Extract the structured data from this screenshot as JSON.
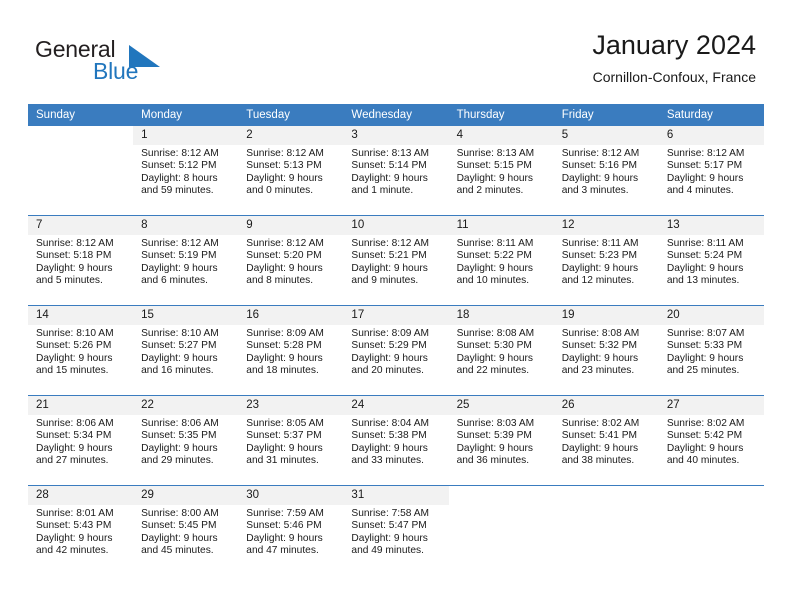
{
  "brand": {
    "word1": "General",
    "word2": "Blue",
    "flag_icon": "blue-triangle-flag-icon",
    "colors": {
      "blue": "#2176bd",
      "dark": "#231f20"
    }
  },
  "header": {
    "title": "January 2024",
    "subtitle": "Cornillon-Confoux, France"
  },
  "theme": {
    "header_blue": "#3a7cbf",
    "date_strip_gray": "#f2f2f2",
    "text": "#1a1a1a"
  },
  "calendar": {
    "weekday_headers": [
      "Sunday",
      "Monday",
      "Tuesday",
      "Wednesday",
      "Thursday",
      "Friday",
      "Saturday"
    ],
    "weeks": [
      [
        {
          "day": "",
          "sunrise": "",
          "sunset": "",
          "daylight1": "",
          "daylight2": ""
        },
        {
          "day": "1",
          "sunrise": "Sunrise: 8:12 AM",
          "sunset": "Sunset: 5:12 PM",
          "daylight1": "Daylight: 8 hours",
          "daylight2": "and 59 minutes."
        },
        {
          "day": "2",
          "sunrise": "Sunrise: 8:12 AM",
          "sunset": "Sunset: 5:13 PM",
          "daylight1": "Daylight: 9 hours",
          "daylight2": "and 0 minutes."
        },
        {
          "day": "3",
          "sunrise": "Sunrise: 8:13 AM",
          "sunset": "Sunset: 5:14 PM",
          "daylight1": "Daylight: 9 hours",
          "daylight2": "and 1 minute."
        },
        {
          "day": "4",
          "sunrise": "Sunrise: 8:13 AM",
          "sunset": "Sunset: 5:15 PM",
          "daylight1": "Daylight: 9 hours",
          "daylight2": "and 2 minutes."
        },
        {
          "day": "5",
          "sunrise": "Sunrise: 8:12 AM",
          "sunset": "Sunset: 5:16 PM",
          "daylight1": "Daylight: 9 hours",
          "daylight2": "and 3 minutes."
        },
        {
          "day": "6",
          "sunrise": "Sunrise: 8:12 AM",
          "sunset": "Sunset: 5:17 PM",
          "daylight1": "Daylight: 9 hours",
          "daylight2": "and 4 minutes."
        }
      ],
      [
        {
          "day": "7",
          "sunrise": "Sunrise: 8:12 AM",
          "sunset": "Sunset: 5:18 PM",
          "daylight1": "Daylight: 9 hours",
          "daylight2": "and 5 minutes."
        },
        {
          "day": "8",
          "sunrise": "Sunrise: 8:12 AM",
          "sunset": "Sunset: 5:19 PM",
          "daylight1": "Daylight: 9 hours",
          "daylight2": "and 6 minutes."
        },
        {
          "day": "9",
          "sunrise": "Sunrise: 8:12 AM",
          "sunset": "Sunset: 5:20 PM",
          "daylight1": "Daylight: 9 hours",
          "daylight2": "and 8 minutes."
        },
        {
          "day": "10",
          "sunrise": "Sunrise: 8:12 AM",
          "sunset": "Sunset: 5:21 PM",
          "daylight1": "Daylight: 9 hours",
          "daylight2": "and 9 minutes."
        },
        {
          "day": "11",
          "sunrise": "Sunrise: 8:11 AM",
          "sunset": "Sunset: 5:22 PM",
          "daylight1": "Daylight: 9 hours",
          "daylight2": "and 10 minutes."
        },
        {
          "day": "12",
          "sunrise": "Sunrise: 8:11 AM",
          "sunset": "Sunset: 5:23 PM",
          "daylight1": "Daylight: 9 hours",
          "daylight2": "and 12 minutes."
        },
        {
          "day": "13",
          "sunrise": "Sunrise: 8:11 AM",
          "sunset": "Sunset: 5:24 PM",
          "daylight1": "Daylight: 9 hours",
          "daylight2": "and 13 minutes."
        }
      ],
      [
        {
          "day": "14",
          "sunrise": "Sunrise: 8:10 AM",
          "sunset": "Sunset: 5:26 PM",
          "daylight1": "Daylight: 9 hours",
          "daylight2": "and 15 minutes."
        },
        {
          "day": "15",
          "sunrise": "Sunrise: 8:10 AM",
          "sunset": "Sunset: 5:27 PM",
          "daylight1": "Daylight: 9 hours",
          "daylight2": "and 16 minutes."
        },
        {
          "day": "16",
          "sunrise": "Sunrise: 8:09 AM",
          "sunset": "Sunset: 5:28 PM",
          "daylight1": "Daylight: 9 hours",
          "daylight2": "and 18 minutes."
        },
        {
          "day": "17",
          "sunrise": "Sunrise: 8:09 AM",
          "sunset": "Sunset: 5:29 PM",
          "daylight1": "Daylight: 9 hours",
          "daylight2": "and 20 minutes."
        },
        {
          "day": "18",
          "sunrise": "Sunrise: 8:08 AM",
          "sunset": "Sunset: 5:30 PM",
          "daylight1": "Daylight: 9 hours",
          "daylight2": "and 22 minutes."
        },
        {
          "day": "19",
          "sunrise": "Sunrise: 8:08 AM",
          "sunset": "Sunset: 5:32 PM",
          "daylight1": "Daylight: 9 hours",
          "daylight2": "and 23 minutes."
        },
        {
          "day": "20",
          "sunrise": "Sunrise: 8:07 AM",
          "sunset": "Sunset: 5:33 PM",
          "daylight1": "Daylight: 9 hours",
          "daylight2": "and 25 minutes."
        }
      ],
      [
        {
          "day": "21",
          "sunrise": "Sunrise: 8:06 AM",
          "sunset": "Sunset: 5:34 PM",
          "daylight1": "Daylight: 9 hours",
          "daylight2": "and 27 minutes."
        },
        {
          "day": "22",
          "sunrise": "Sunrise: 8:06 AM",
          "sunset": "Sunset: 5:35 PM",
          "daylight1": "Daylight: 9 hours",
          "daylight2": "and 29 minutes."
        },
        {
          "day": "23",
          "sunrise": "Sunrise: 8:05 AM",
          "sunset": "Sunset: 5:37 PM",
          "daylight1": "Daylight: 9 hours",
          "daylight2": "and 31 minutes."
        },
        {
          "day": "24",
          "sunrise": "Sunrise: 8:04 AM",
          "sunset": "Sunset: 5:38 PM",
          "daylight1": "Daylight: 9 hours",
          "daylight2": "and 33 minutes."
        },
        {
          "day": "25",
          "sunrise": "Sunrise: 8:03 AM",
          "sunset": "Sunset: 5:39 PM",
          "daylight1": "Daylight: 9 hours",
          "daylight2": "and 36 minutes."
        },
        {
          "day": "26",
          "sunrise": "Sunrise: 8:02 AM",
          "sunset": "Sunset: 5:41 PM",
          "daylight1": "Daylight: 9 hours",
          "daylight2": "and 38 minutes."
        },
        {
          "day": "27",
          "sunrise": "Sunrise: 8:02 AM",
          "sunset": "Sunset: 5:42 PM",
          "daylight1": "Daylight: 9 hours",
          "daylight2": "and 40 minutes."
        }
      ],
      [
        {
          "day": "28",
          "sunrise": "Sunrise: 8:01 AM",
          "sunset": "Sunset: 5:43 PM",
          "daylight1": "Daylight: 9 hours",
          "daylight2": "and 42 minutes."
        },
        {
          "day": "29",
          "sunrise": "Sunrise: 8:00 AM",
          "sunset": "Sunset: 5:45 PM",
          "daylight1": "Daylight: 9 hours",
          "daylight2": "and 45 minutes."
        },
        {
          "day": "30",
          "sunrise": "Sunrise: 7:59 AM",
          "sunset": "Sunset: 5:46 PM",
          "daylight1": "Daylight: 9 hours",
          "daylight2": "and 47 minutes."
        },
        {
          "day": "31",
          "sunrise": "Sunrise: 7:58 AM",
          "sunset": "Sunset: 5:47 PM",
          "daylight1": "Daylight: 9 hours",
          "daylight2": "and 49 minutes."
        },
        {
          "day": "",
          "sunrise": "",
          "sunset": "",
          "daylight1": "",
          "daylight2": ""
        },
        {
          "day": "",
          "sunrise": "",
          "sunset": "",
          "daylight1": "",
          "daylight2": ""
        },
        {
          "day": "",
          "sunrise": "",
          "sunset": "",
          "daylight1": "",
          "daylight2": ""
        }
      ]
    ]
  }
}
